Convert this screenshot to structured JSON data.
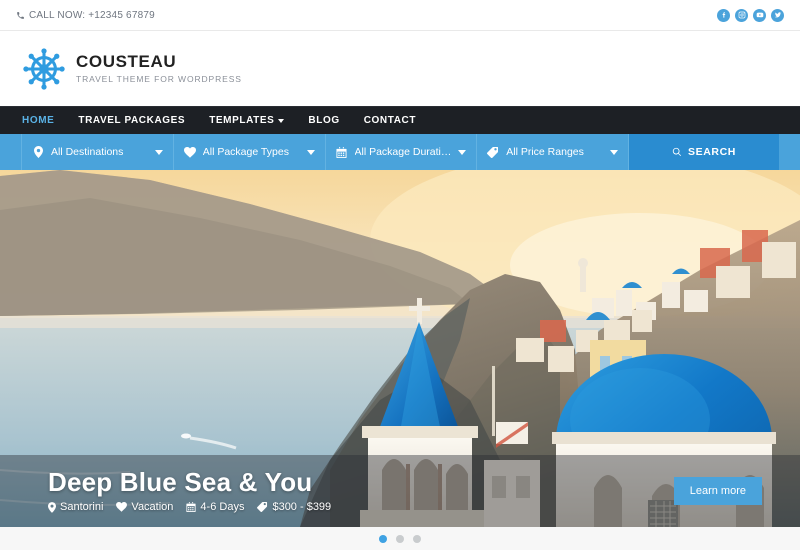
{
  "topbar": {
    "phone_icon": "phone-icon",
    "phone_text": "CALL NOW: +12345 67879",
    "socials": [
      {
        "name": "facebook-icon",
        "label": "Facebook"
      },
      {
        "name": "instagram-icon",
        "label": "Instagram"
      },
      {
        "name": "youtube-icon",
        "label": "YouTube"
      },
      {
        "name": "twitter-icon",
        "label": "Twitter"
      }
    ]
  },
  "header": {
    "logo_icon": "ship-wheel-icon",
    "brand_name": "COUSTEAU",
    "brand_tagline": "TRAVEL THEME FOR WORDPRESS"
  },
  "nav": {
    "items": [
      {
        "label": "HOME",
        "active": true,
        "dropdown": false
      },
      {
        "label": "TRAVEL PACKAGES",
        "active": false,
        "dropdown": false
      },
      {
        "label": "TEMPLATES",
        "active": false,
        "dropdown": true
      },
      {
        "label": "BLOG",
        "active": false,
        "dropdown": false
      },
      {
        "label": "CONTACT",
        "active": false,
        "dropdown": false
      }
    ]
  },
  "filters": {
    "items": [
      {
        "icon": "map-pin-icon",
        "value": "All Destinations"
      },
      {
        "icon": "heart-icon",
        "value": "All Package Types"
      },
      {
        "icon": "calendar-icon",
        "value": "All Package Durations"
      },
      {
        "icon": "tag-icon",
        "value": "All Price Ranges"
      }
    ],
    "search_label": "SEARCH",
    "search_icon": "search-icon"
  },
  "hero": {
    "slide": {
      "title": "Deep Blue Sea & You",
      "meta": [
        {
          "icon": "map-pin-icon",
          "text": "Santorini"
        },
        {
          "icon": "heart-icon",
          "text": "Vacation"
        },
        {
          "icon": "calendar-icon",
          "text": "4-6 Days"
        },
        {
          "icon": "tag-icon",
          "text": "$300 - $399"
        }
      ],
      "cta_label": "Learn more"
    },
    "dots": [
      {
        "active": true
      },
      {
        "active": false
      },
      {
        "active": false
      }
    ]
  },
  "colors": {
    "accent_blue": "#4aa3db",
    "search_blue": "#2a8cd0",
    "nav_dark": "#1d2025",
    "nav_active": "#5ab2e6"
  }
}
